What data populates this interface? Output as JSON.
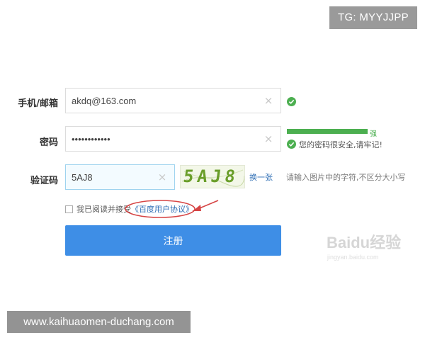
{
  "overlay_tag": "TG: MYYJJPP",
  "form": {
    "account": {
      "label": "手机/邮箱",
      "value": "akdq@163.com"
    },
    "password": {
      "label": "密码",
      "value": "••••••••••••",
      "strength_label": "强",
      "hint": "您的密码很安全,请牢记!"
    },
    "captcha": {
      "label": "验证码",
      "value": "5AJ8",
      "image_text": "5AJ8",
      "refresh_label": "换一张",
      "hint": "请输入图片中的字符,不区分大小写"
    },
    "agreement": {
      "prefix": "我已阅读并接受",
      "link": "《百度用户协议》",
      "checked": false
    },
    "submit_label": "注册"
  },
  "watermark": {
    "logo": "Baidu经验",
    "sub": "jingyan.baidu.com"
  },
  "site_banner": "www.kaihuaomen-duchang.com",
  "colors": {
    "primary": "#3e8ee6",
    "success": "#4caf50",
    "link": "#2d6db4",
    "annotation": "#d64545"
  }
}
